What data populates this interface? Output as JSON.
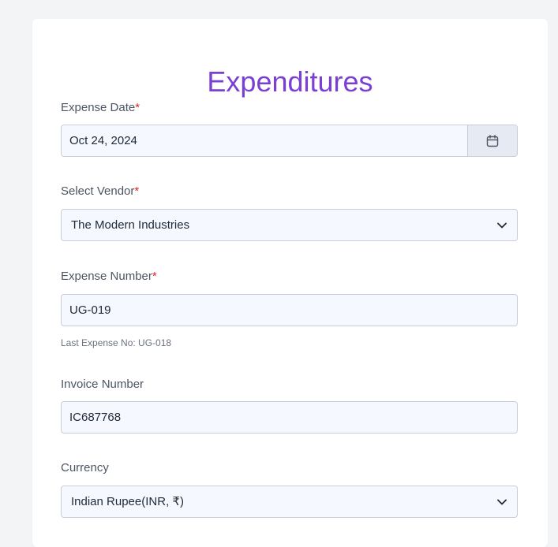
{
  "form": {
    "title": "Expenditures",
    "expense_date": {
      "label": "Expense Date",
      "required_mark": "*",
      "value": "Oct 24, 2024"
    },
    "vendor": {
      "label": "Select Vendor",
      "required_mark": "*",
      "value": "The Modern Industries"
    },
    "expense_number": {
      "label": "Expense Number",
      "required_mark": "*",
      "value": "UG-019",
      "hint": "Last Expense No: UG-018"
    },
    "invoice_number": {
      "label": "Invoice Number",
      "value": "IC687768"
    },
    "currency": {
      "label": "Currency",
      "value": "Indian Rupee(INR, ₹)"
    }
  },
  "icons": {
    "date_picker": "calendar-icon",
    "dropdown": "chevron-down-icon"
  },
  "colors": {
    "title": "#7b3fd6",
    "required": "#dc2626",
    "field_bg": "#f5f8ff",
    "field_border": "#c7cdd9"
  }
}
